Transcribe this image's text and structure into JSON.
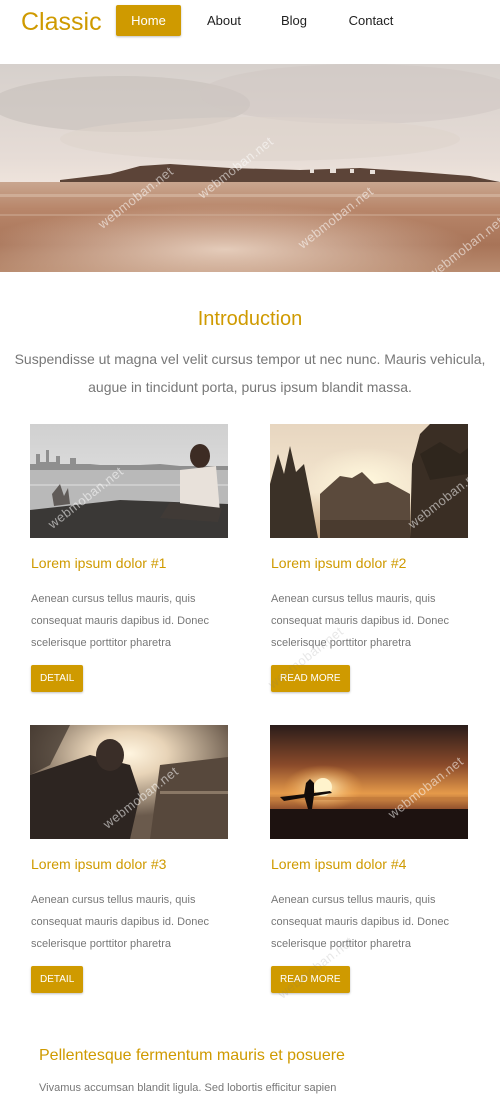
{
  "header": {
    "logo": "Classic",
    "nav": [
      {
        "label": "Home",
        "active": true
      },
      {
        "label": "About",
        "active": false
      },
      {
        "label": "Blog",
        "active": false
      },
      {
        "label": "Contact",
        "active": false
      }
    ]
  },
  "intro": {
    "title": "Introduction",
    "text": "Suspendisse ut magna vel velit cursus tempor ut nec nunc. Mauris vehicula, augue in tincidunt porta, purus ipsum blandit massa."
  },
  "cards": [
    {
      "title": "Lorem ipsum dolor #1",
      "text": "Aenean cursus tellus mauris, quis consequat mauris dapibus id. Donec scelerisque porttitor pharetra",
      "button": "DETAIL"
    },
    {
      "title": "Lorem ipsum dolor #2",
      "text": "Aenean cursus tellus mauris, quis consequat mauris dapibus id. Donec scelerisque porttitor pharetra",
      "button": "READ MORE"
    },
    {
      "title": "Lorem ipsum dolor #3",
      "text": "Aenean cursus tellus mauris, quis consequat mauris dapibus id. Donec scelerisque porttitor pharetra",
      "button": "DETAIL"
    },
    {
      "title": "Lorem ipsum dolor #4",
      "text": "Aenean cursus tellus mauris, quis consequat mauris dapibus id. Donec scelerisque porttitor pharetra",
      "button": "READ MORE"
    }
  ],
  "bottom": {
    "title": "Pellentesque fermentum mauris et posuere",
    "text": "Vivamus accumsan blandit ligula. Sed lobortis efficitur sapien"
  },
  "watermark": "webmoban.net",
  "colors": {
    "accent": "#cf9a00",
    "text": "#777777",
    "background": "#ffffff"
  }
}
